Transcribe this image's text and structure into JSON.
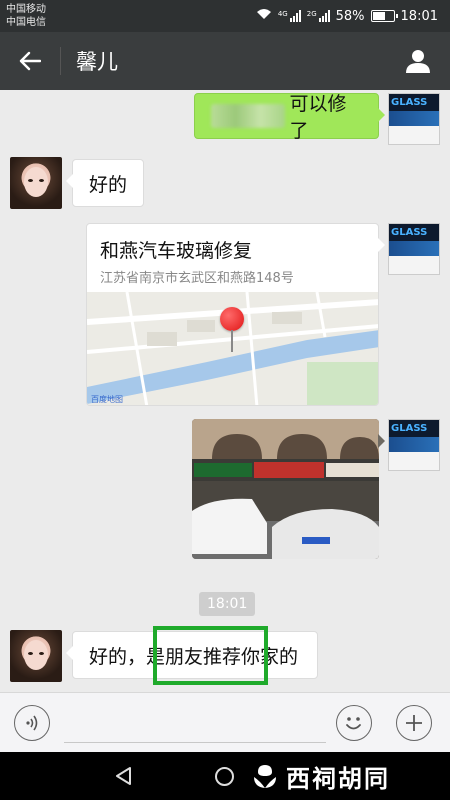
{
  "status_bar": {
    "carrier_1": "中国移动",
    "carrier_2": "中国电信",
    "net_1": "4G",
    "net_2": "2G",
    "battery": "58%",
    "time": "18:01"
  },
  "header": {
    "title": "馨儿"
  },
  "messages": {
    "m1_text": "可以修了",
    "m2_text": "好的",
    "location": {
      "title": "和燕汽车玻璃修复",
      "address": "江苏省南京市玄武区和燕路148号",
      "map_logo": "百度地图"
    },
    "timestamp": "18:01",
    "m5_text": "好的，是朋友推荐你家的"
  },
  "self_avatar": {
    "brand": "GLASS"
  },
  "input_bar": {
    "placeholder": ""
  },
  "nav_bar": {
    "watermark": "西祠胡同"
  },
  "colors": {
    "status_bg": "#2e3132",
    "title_bg": "#3a3d3e",
    "chat_bg": "#ebebeb",
    "bubble_green": "#a0e759",
    "highlight": "#1faa2b",
    "pin_red": "#e01414"
  }
}
